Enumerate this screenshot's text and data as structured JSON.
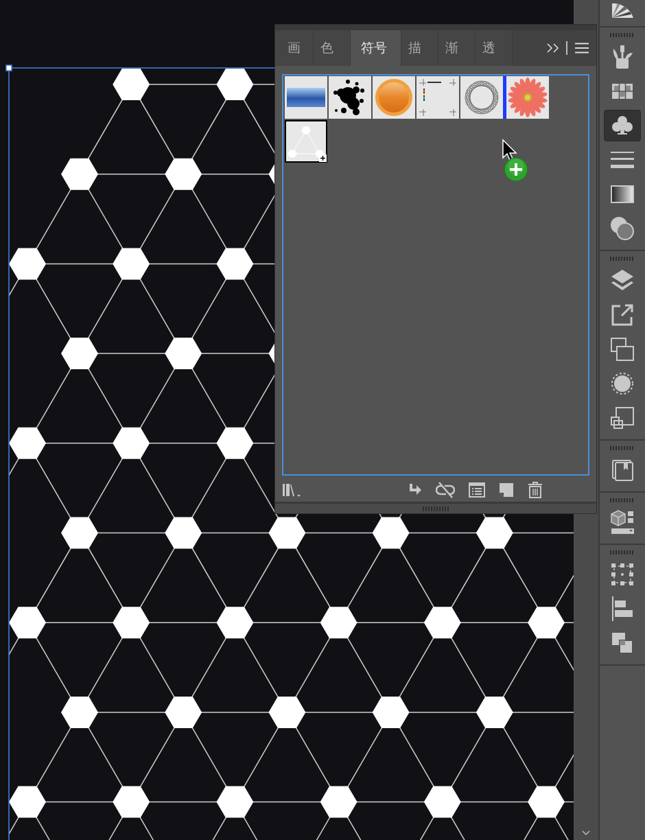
{
  "symbols_panel": {
    "tabs": [
      {
        "label": "画",
        "selected": false
      },
      {
        "label": "色",
        "selected": false
      },
      {
        "label": "符号",
        "selected": true
      },
      {
        "label": "描",
        "selected": false
      },
      {
        "label": "渐",
        "selected": false
      },
      {
        "label": "透",
        "selected": false
      }
    ],
    "symbols": [
      {
        "kind": "gradient",
        "selected": false,
        "drop_target": false
      },
      {
        "kind": "splash",
        "selected": false,
        "drop_target": false
      },
      {
        "kind": "orb",
        "selected": false,
        "drop_target": false
      },
      {
        "kind": "marks",
        "selected": false,
        "drop_target": false
      },
      {
        "kind": "ring",
        "selected": false,
        "drop_target": false
      },
      {
        "kind": "flower",
        "selected": false,
        "drop_target": true
      },
      {
        "kind": "hexagons",
        "selected": true,
        "drop_target": false
      }
    ]
  },
  "toolbar": {
    "groups": [
      {
        "tools": [
          {
            "kind": "fan",
            "selected": false
          }
        ]
      },
      {
        "tools": [
          {
            "kind": "brushes",
            "selected": false
          },
          {
            "kind": "grid",
            "selected": false
          },
          {
            "kind": "club",
            "selected": true
          },
          {
            "kind": "lines",
            "selected": false
          },
          {
            "kind": "gradient",
            "selected": false
          },
          {
            "kind": "circles",
            "selected": false
          }
        ]
      },
      {
        "tools": [
          {
            "kind": "layers",
            "selected": false
          },
          {
            "kind": "export",
            "selected": false
          },
          {
            "kind": "overlap",
            "selected": false
          },
          {
            "kind": "dashed",
            "selected": false
          },
          {
            "kind": "squares",
            "selected": false
          }
        ]
      },
      {
        "tools": [
          {
            "kind": "book",
            "selected": false
          }
        ]
      },
      {
        "tools": [
          {
            "kind": "cube",
            "selected": false
          }
        ]
      },
      {
        "tools": [
          {
            "kind": "bbox",
            "selected": false
          },
          {
            "kind": "align",
            "selected": false
          },
          {
            "kind": "pathfinder",
            "selected": false
          }
        ]
      }
    ]
  }
}
